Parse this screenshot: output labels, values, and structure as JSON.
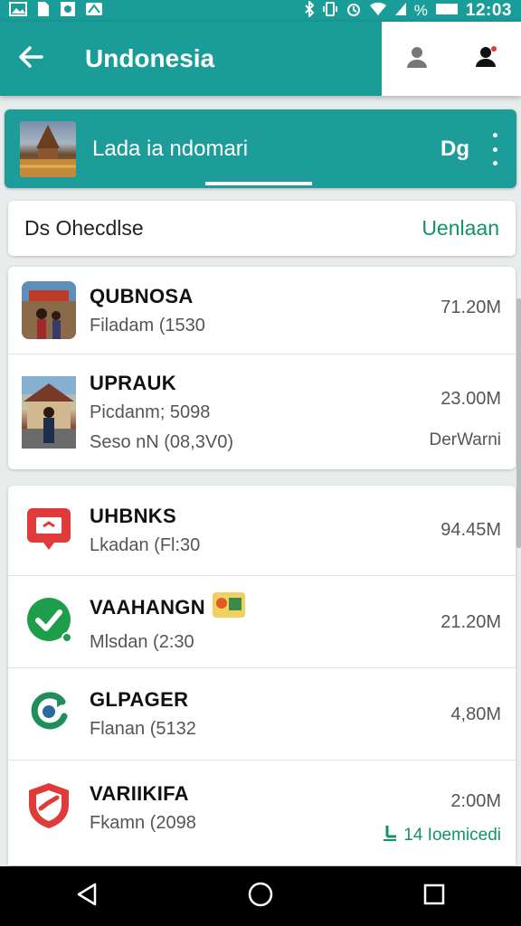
{
  "status_bar": {
    "time": "12:03",
    "battery_label": "%",
    "left_icons": [
      "image-icon",
      "file-icon",
      "gallery-icon",
      "map-icon"
    ],
    "right_icons": [
      "bluetooth-icon",
      "vibrate-icon",
      "alarm-icon",
      "wifi-icon",
      "signal-icon",
      "battery-icon"
    ]
  },
  "appbar": {
    "title": "Undonesia",
    "back_icon": "arrow-left-icon",
    "actions": [
      "account-icon",
      "notification-person-icon"
    ]
  },
  "banner": {
    "title": "Lada ia ndomari",
    "right_label": "Dg",
    "menu_icon": "more-vert-icon"
  },
  "section_header": {
    "title": "Ds Ohecdlse",
    "link": "Uenlaan"
  },
  "list1": [
    {
      "title": "QUBNOSA",
      "sub": "Filadam (1530",
      "size": "71.20M",
      "icon": "photo-thumb"
    },
    {
      "title": "UPRAUK",
      "sub": "Picdanm; 5098",
      "sub2": "Seso nN (08,3V0)",
      "size": "23.00M",
      "extra": "DerWarni",
      "icon": "photo-thumb"
    }
  ],
  "list2": [
    {
      "title": "UHBNKS",
      "sub": "Lkadan (Fl:30",
      "size": "94.45M",
      "icon": "red-chat-icon",
      "color": "#e03a3a"
    },
    {
      "title": "VAAHANGN",
      "sub": "Mlsdan (2:30",
      "size": "21.20M",
      "icon": "green-check-icon",
      "color": "#1e9e4a"
    },
    {
      "title": "GLPAGER",
      "sub": "Flanan (5132",
      "size": "4,80M",
      "icon": "green-refresh-icon",
      "color": "#1e8e5a"
    },
    {
      "title": "VARIIKIFA",
      "sub": "Fkamn (2098",
      "size": "2:00M",
      "extra": "14 Ioemicedi",
      "icon": "red-shield-icon",
      "color": "#e03a3a"
    }
  ],
  "colors": {
    "primary": "#1a9c99",
    "accent_green": "#11936a",
    "red": "#e03a3a"
  },
  "navbar": {
    "icons": [
      "back-triangle-icon",
      "home-circle-icon",
      "recents-square-icon"
    ]
  }
}
